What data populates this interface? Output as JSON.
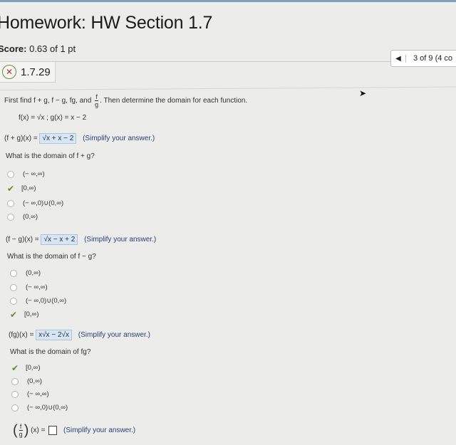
{
  "header": {
    "title": "Homework: HW Section 1.7",
    "score_label": "Score:",
    "score_value": "0.63 of 1 pt"
  },
  "nav": {
    "position": "3 of 9 (4 co"
  },
  "question": {
    "number": "1.7.29",
    "instruction_a": "First find f + g, f − g, fg, and",
    "frac_num": "f",
    "frac_den": "g",
    "instruction_b": ". Then determine the domain for each function.",
    "given": "f(x) = √x ; g(x) = x − 2"
  },
  "parts": {
    "sum": {
      "label": "(f + g)(x) =",
      "answer": "√x + x − 2",
      "hint": "(Simplify your answer.)",
      "domain_q": "What is the domain of f + g?",
      "options": [
        "(− ∞,∞)",
        "[0,∞)",
        "(− ∞,0)∪(0,∞)",
        "(0,∞)"
      ]
    },
    "diff": {
      "label": "(f − g)(x) =",
      "answer": "√x − x + 2",
      "hint": "(Simplify your answer.)",
      "domain_q": "What is the domain of f − g?",
      "options": [
        "(0,∞)",
        "(− ∞,∞)",
        "(− ∞,0)∪(0,∞)",
        "[0,∞)"
      ]
    },
    "prod": {
      "label": "(fg)(x) =",
      "answer": "x√x − 2√x",
      "hint": "(Simplify your answer.)",
      "domain_q": "What is the domain of fg?",
      "options": [
        "[0,∞)",
        "(0,∞)",
        "(− ∞,∞)",
        "(− ∞,0)∪(0,∞)"
      ]
    },
    "quot": {
      "num": "f",
      "den": "g",
      "label": "(x) =",
      "hint": "(Simplify your answer.)"
    }
  }
}
